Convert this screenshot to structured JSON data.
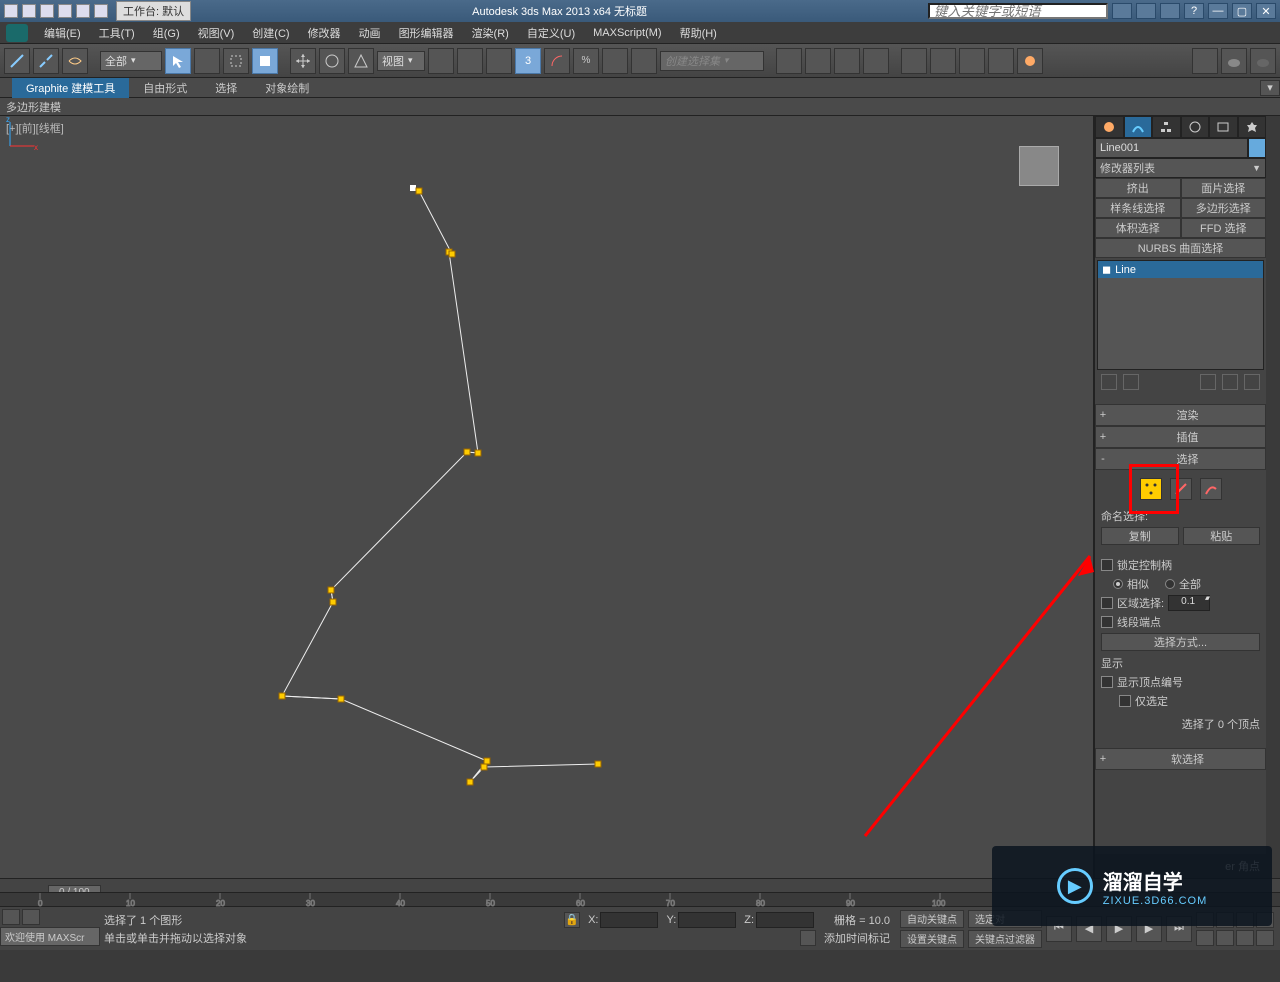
{
  "titlebar": {
    "workspace": "工作台: 默认",
    "app_title": "Autodesk 3ds Max  2013 x64     无标题",
    "search_placeholder": "键入关键字或短语"
  },
  "menu": {
    "edit": "编辑(E)",
    "tools": "工具(T)",
    "group": "组(G)",
    "views": "视图(V)",
    "create": "创建(C)",
    "modifiers": "修改器",
    "animation": "动画",
    "graph": "图形编辑器",
    "render": "渲染(R)",
    "customize": "自定义(U)",
    "maxscript": "MAXScript(M)",
    "help": "帮助(H)"
  },
  "toolbar": {
    "filter": "全部",
    "ref_coord": "视图",
    "named_sel": "创建选择集"
  },
  "ribbon": {
    "graphite": "Graphite 建模工具",
    "freeform": "自由形式",
    "selection": "选择",
    "objpaint": "对象绘制",
    "polymodel": "多边形建模"
  },
  "viewport": {
    "label": "[+][前][线框]"
  },
  "panel": {
    "obj_name": "Line001",
    "mod_list": "修改器列表",
    "btn_extrude": "挤出",
    "btn_facesel": "面片选择",
    "btn_splinesel": "样条线选择",
    "btn_polysel": "多边形选择",
    "btn_volsel": "体积选择",
    "btn_ffdsel": "FFD 选择",
    "btn_nurbs": "NURBS 曲面选择",
    "stack_line": "Line",
    "roll_render": "渲染",
    "roll_interp": "插值",
    "roll_select": "选择",
    "named_sel_label": "命名选择:",
    "btn_copy": "复制",
    "btn_paste": "粘贴",
    "lock_handles": "锁定控制柄",
    "similar": "相似",
    "all": "全部",
    "area_sel": "区域选择:",
    "area_val": "0.1",
    "seg_end": "线段端点",
    "sel_method": "选择方式...",
    "display": "显示",
    "show_vtx_num": "显示顶点编号",
    "only_sel": "仅选定",
    "sel_count": "选择了 0 个顶点",
    "roll_softsel": "软选择",
    "corner_label": "er 角点"
  },
  "timeline": {
    "slider": "0 / 100"
  },
  "status": {
    "welcome": "欢迎使用  MAXScr",
    "sel_info": "选择了 1 个图形",
    "hint": "单击或单击并拖动以选择对象",
    "grid": "栅格 = 10.0",
    "add_time_tag": "添加时间标记",
    "auto_key": "自动关键点",
    "set_key": "设置关键点",
    "sel_set": "选定对",
    "key_filter": "关键点过滤器"
  },
  "watermark": {
    "brand": "溜溜自学",
    "url": "ZIXUE.3D66.COM"
  }
}
